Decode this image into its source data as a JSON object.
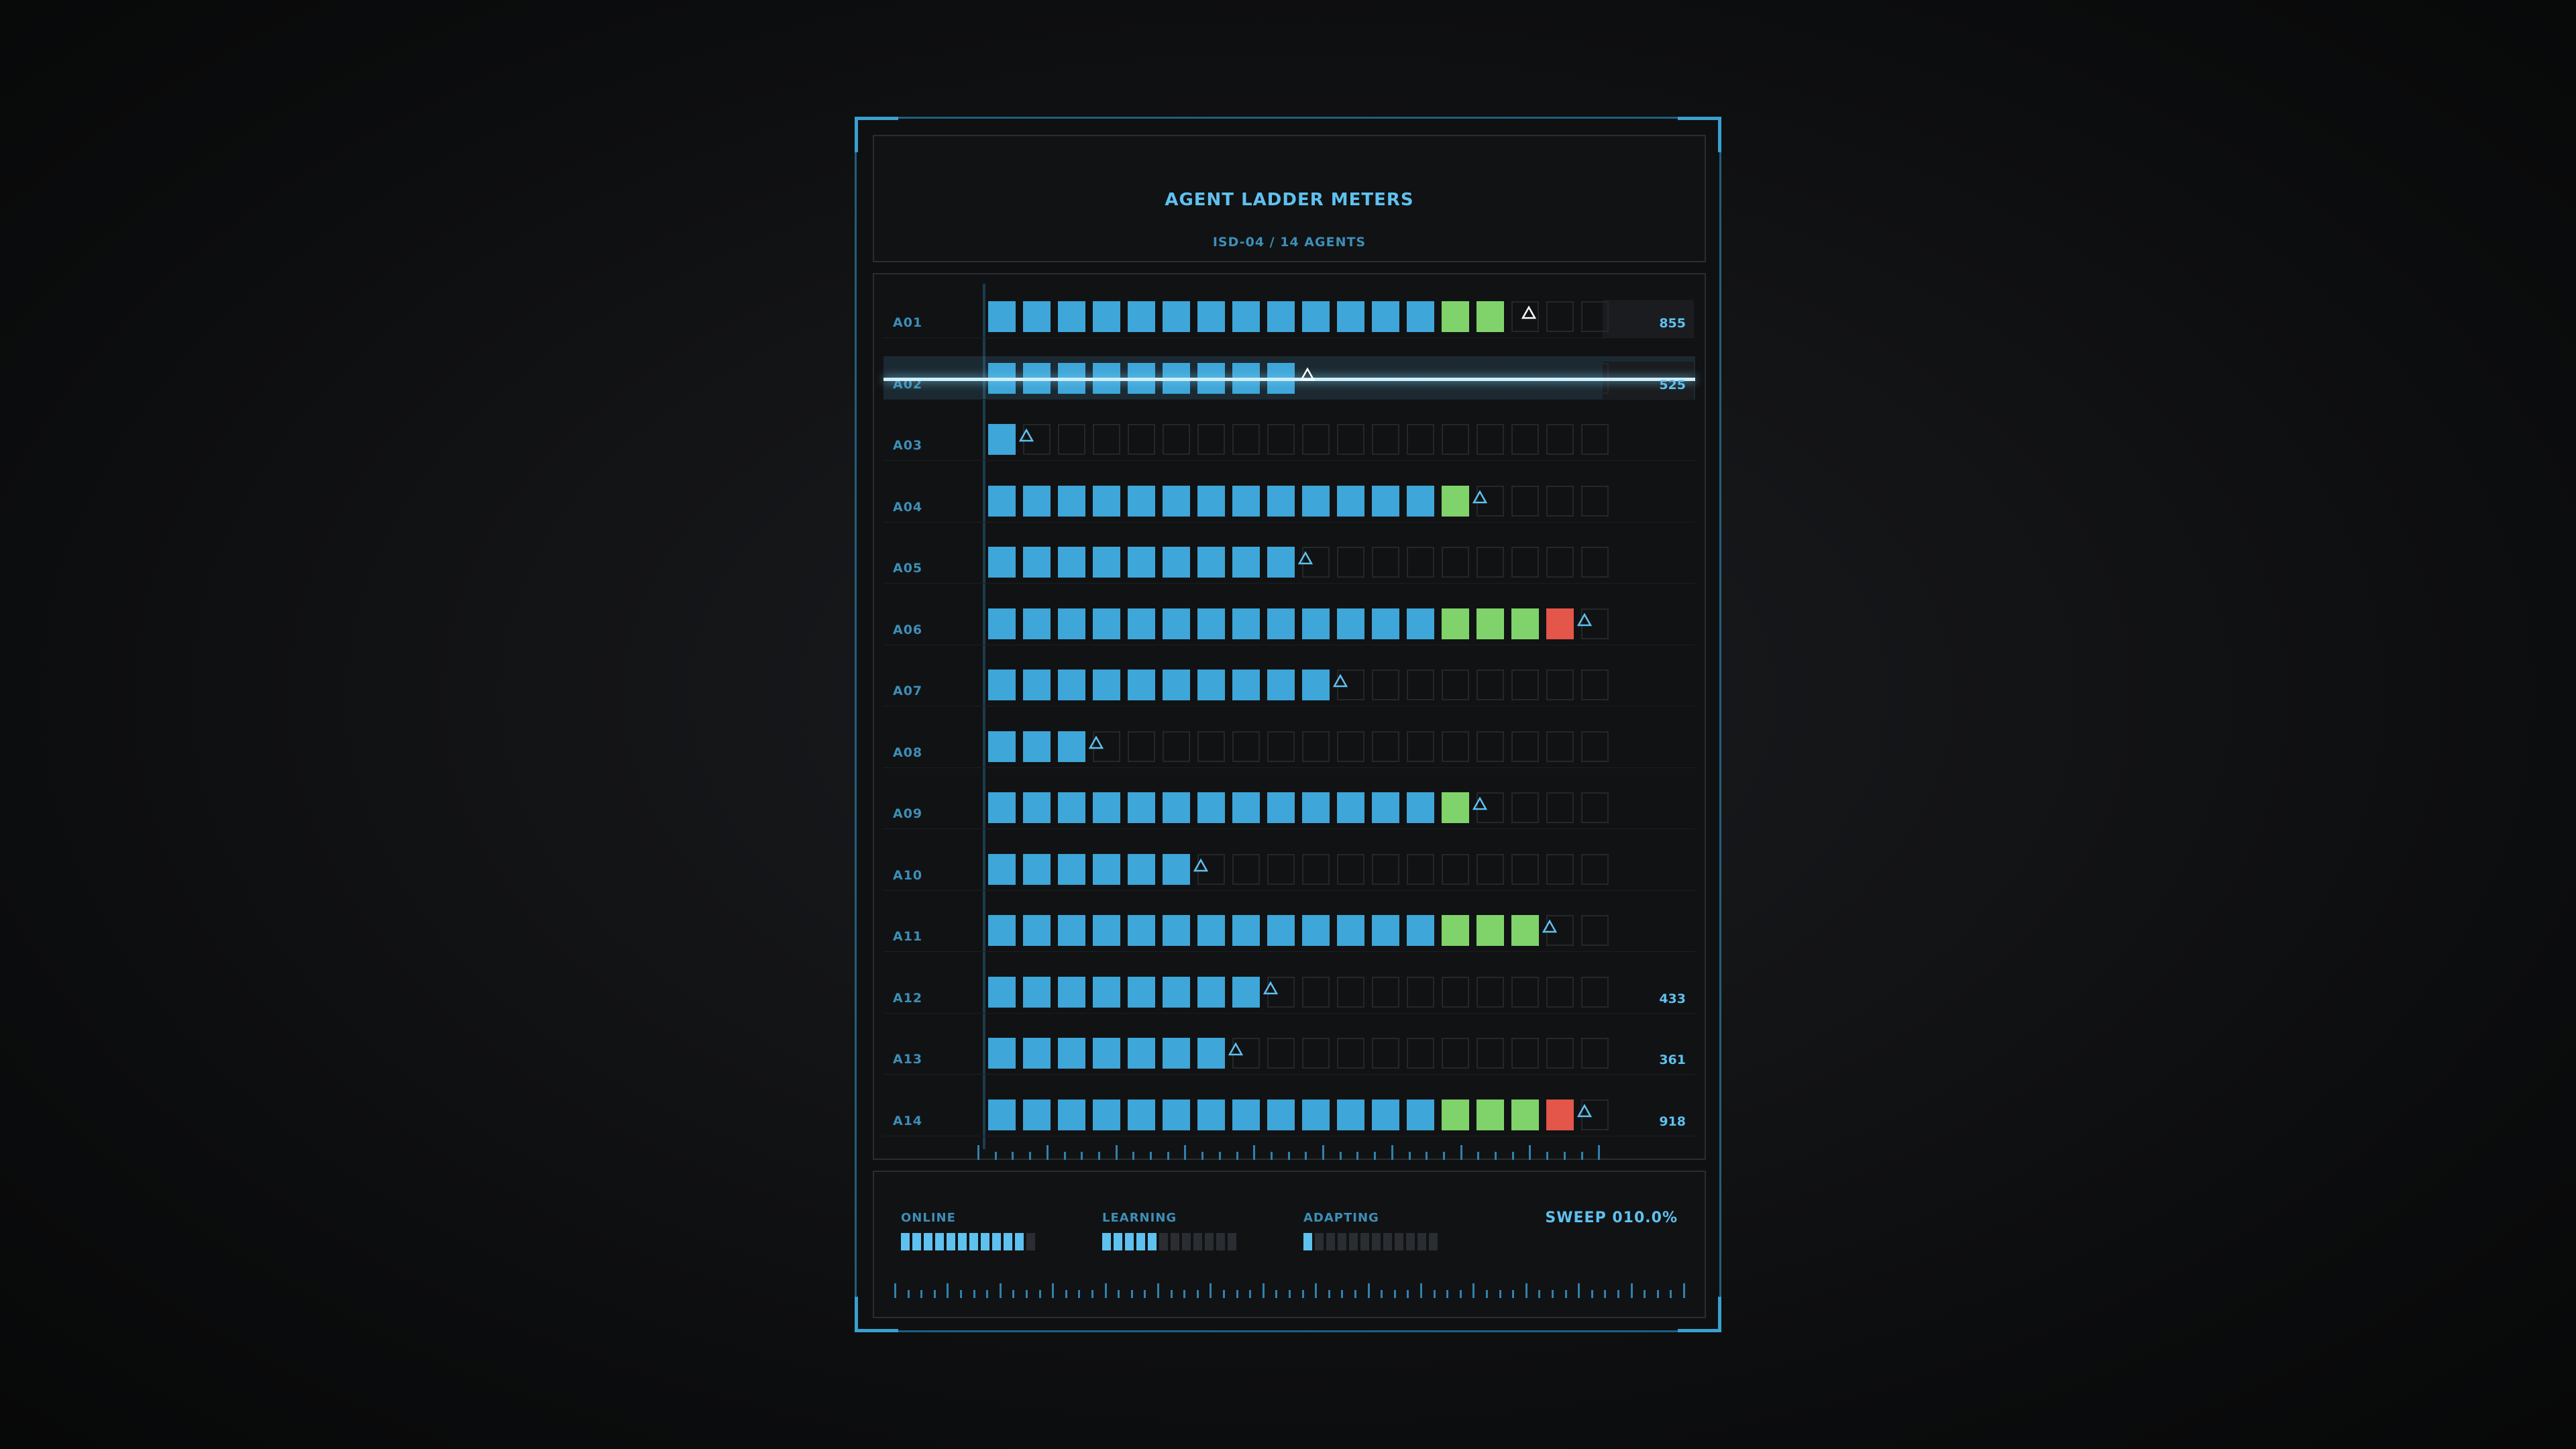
{
  "header": {
    "title": "AGENT LADDER METERS",
    "subtitle": "ISD-04 / 14 AGENTS"
  },
  "meters": {
    "cells_per_row": 18,
    "colors": {
      "blue": "#3ea6d8",
      "green": "#7fd36a",
      "red": "#e4554a",
      "marker": "#5fc1ef",
      "marker_highlight": "#ffffff"
    },
    "rows": [
      {
        "label": "A01",
        "value": "855",
        "filled": 15,
        "greens": 2,
        "red": false,
        "marker_at": 15.4,
        "value_box": true
      },
      {
        "label": "A02",
        "value": "525",
        "filled": 9,
        "greens": 0,
        "red": false,
        "marker_at": 9.05,
        "value_box": true,
        "highlighted": true
      },
      {
        "label": "A03",
        "value": "",
        "filled": 1,
        "greens": 0,
        "red": false,
        "marker_at": 1.0
      },
      {
        "label": "A04",
        "value": "",
        "filled": 14,
        "greens": 1,
        "red": false,
        "marker_at": 14.0
      },
      {
        "label": "A05",
        "value": "",
        "filled": 9,
        "greens": 0,
        "red": false,
        "marker_at": 9.0
      },
      {
        "label": "A06",
        "value": "",
        "filled": 17,
        "greens": 3,
        "red": true,
        "marker_at": 17.0
      },
      {
        "label": "A07",
        "value": "",
        "filled": 10,
        "greens": 0,
        "red": false,
        "marker_at": 10.0
      },
      {
        "label": "A08",
        "value": "",
        "filled": 3,
        "greens": 0,
        "red": false,
        "marker_at": 3.0
      },
      {
        "label": "A09",
        "value": "",
        "filled": 14,
        "greens": 1,
        "red": false,
        "marker_at": 14.0
      },
      {
        "label": "A10",
        "value": "",
        "filled": 6,
        "greens": 0,
        "red": false,
        "marker_at": 6.0
      },
      {
        "label": "A11",
        "value": "",
        "filled": 16,
        "greens": 3,
        "red": false,
        "marker_at": 16.0
      },
      {
        "label": "A12",
        "value": "433",
        "filled": 8,
        "greens": 0,
        "red": false,
        "marker_at": 8.0
      },
      {
        "label": "A13",
        "value": "361",
        "filled": 7,
        "greens": 0,
        "red": false,
        "marker_at": 7.0
      },
      {
        "label": "A14",
        "value": "918",
        "filled": 17,
        "greens": 3,
        "red": true,
        "marker_at": 17.0
      }
    ]
  },
  "footer": {
    "online": {
      "label": "ONLINE",
      "on": 11,
      "total": 12
    },
    "learning": {
      "label": "LEARNING",
      "on": 5,
      "total": 12
    },
    "adapting": {
      "label": "ADAPTING",
      "on": 1,
      "total": 12
    },
    "sweep": "SWEEP 010.0%"
  }
}
